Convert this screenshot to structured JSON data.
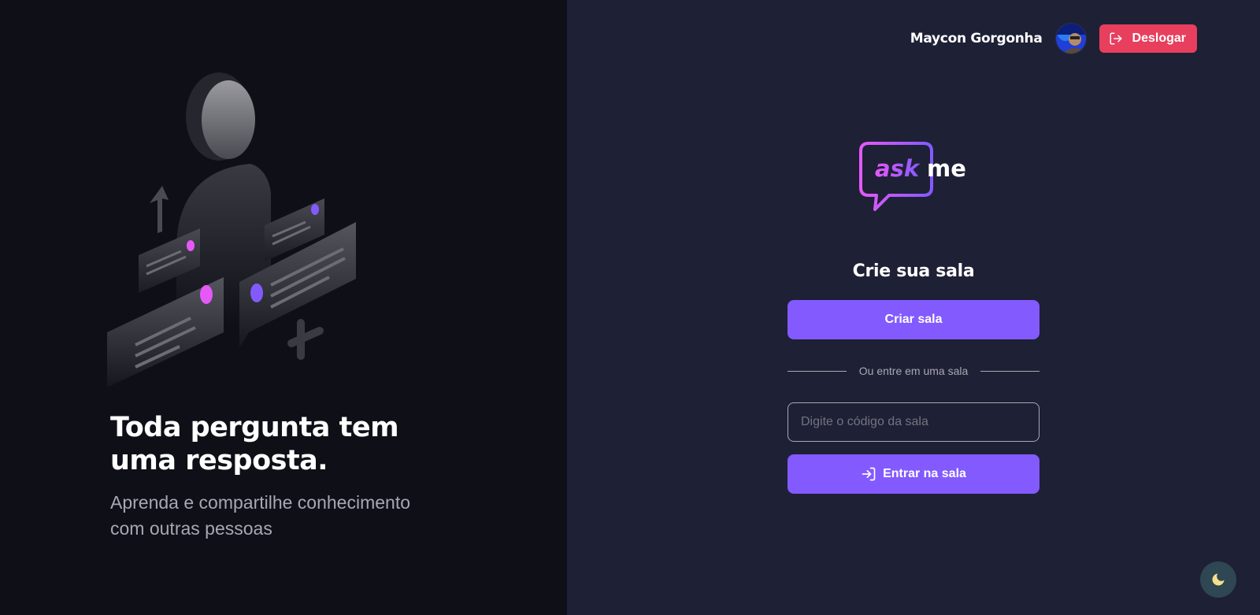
{
  "hero": {
    "title": "Toda pergunta tem uma resposta.",
    "subtitle": "Aprenda e compartilhe conhecimento com outras pessoas"
  },
  "header": {
    "user_name": "Maycon Gorgonha",
    "logout_label": "Deslogar",
    "logout_icon": "log-out-icon"
  },
  "logo": {
    "part1": "ask",
    "part2": "me"
  },
  "main": {
    "title": "Crie sua sala",
    "create_room_label": "Criar sala",
    "separator_label": "Ou entre em uma sala",
    "room_code": {
      "value": "",
      "placeholder": "Digite o código da sala"
    },
    "enter_room_label": "Entrar na sala",
    "enter_room_icon": "log-in-icon"
  },
  "theme_toggle": {
    "icon": "moon-icon"
  },
  "colors": {
    "primary": "#835afd",
    "danger": "#e73f5d",
    "background_left": "#0f0f17",
    "background_right": "#1e2035",
    "muted_text": "#a8a8b3",
    "logo_gradient_start": "#e559f9",
    "logo_gradient_end": "#835afd"
  }
}
